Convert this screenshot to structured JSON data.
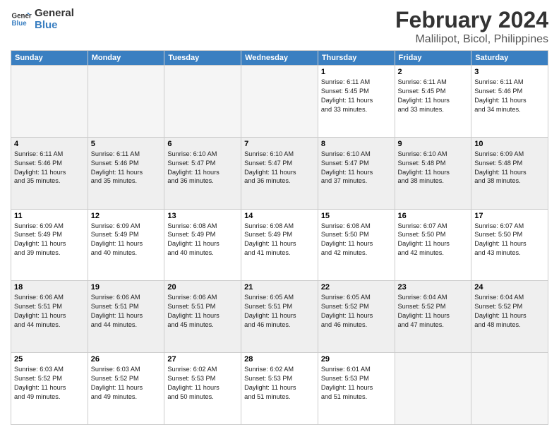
{
  "header": {
    "logo_line1": "General",
    "logo_line2": "Blue",
    "month": "February 2024",
    "location": "Malilipot, Bicol, Philippines"
  },
  "weekdays": [
    "Sunday",
    "Monday",
    "Tuesday",
    "Wednesday",
    "Thursday",
    "Friday",
    "Saturday"
  ],
  "weeks": [
    [
      {
        "day": "",
        "info": "",
        "empty": true
      },
      {
        "day": "",
        "info": "",
        "empty": true
      },
      {
        "day": "",
        "info": "",
        "empty": true
      },
      {
        "day": "",
        "info": "",
        "empty": true
      },
      {
        "day": "1",
        "info": "Sunrise: 6:11 AM\nSunset: 5:45 PM\nDaylight: 11 hours\nand 33 minutes."
      },
      {
        "day": "2",
        "info": "Sunrise: 6:11 AM\nSunset: 5:45 PM\nDaylight: 11 hours\nand 33 minutes."
      },
      {
        "day": "3",
        "info": "Sunrise: 6:11 AM\nSunset: 5:46 PM\nDaylight: 11 hours\nand 34 minutes."
      }
    ],
    [
      {
        "day": "4",
        "info": "Sunrise: 6:11 AM\nSunset: 5:46 PM\nDaylight: 11 hours\nand 35 minutes."
      },
      {
        "day": "5",
        "info": "Sunrise: 6:11 AM\nSunset: 5:46 PM\nDaylight: 11 hours\nand 35 minutes."
      },
      {
        "day": "6",
        "info": "Sunrise: 6:10 AM\nSunset: 5:47 PM\nDaylight: 11 hours\nand 36 minutes."
      },
      {
        "day": "7",
        "info": "Sunrise: 6:10 AM\nSunset: 5:47 PM\nDaylight: 11 hours\nand 36 minutes."
      },
      {
        "day": "8",
        "info": "Sunrise: 6:10 AM\nSunset: 5:47 PM\nDaylight: 11 hours\nand 37 minutes."
      },
      {
        "day": "9",
        "info": "Sunrise: 6:10 AM\nSunset: 5:48 PM\nDaylight: 11 hours\nand 38 minutes."
      },
      {
        "day": "10",
        "info": "Sunrise: 6:09 AM\nSunset: 5:48 PM\nDaylight: 11 hours\nand 38 minutes."
      }
    ],
    [
      {
        "day": "11",
        "info": "Sunrise: 6:09 AM\nSunset: 5:49 PM\nDaylight: 11 hours\nand 39 minutes."
      },
      {
        "day": "12",
        "info": "Sunrise: 6:09 AM\nSunset: 5:49 PM\nDaylight: 11 hours\nand 40 minutes."
      },
      {
        "day": "13",
        "info": "Sunrise: 6:08 AM\nSunset: 5:49 PM\nDaylight: 11 hours\nand 40 minutes."
      },
      {
        "day": "14",
        "info": "Sunrise: 6:08 AM\nSunset: 5:49 PM\nDaylight: 11 hours\nand 41 minutes."
      },
      {
        "day": "15",
        "info": "Sunrise: 6:08 AM\nSunset: 5:50 PM\nDaylight: 11 hours\nand 42 minutes."
      },
      {
        "day": "16",
        "info": "Sunrise: 6:07 AM\nSunset: 5:50 PM\nDaylight: 11 hours\nand 42 minutes."
      },
      {
        "day": "17",
        "info": "Sunrise: 6:07 AM\nSunset: 5:50 PM\nDaylight: 11 hours\nand 43 minutes."
      }
    ],
    [
      {
        "day": "18",
        "info": "Sunrise: 6:06 AM\nSunset: 5:51 PM\nDaylight: 11 hours\nand 44 minutes."
      },
      {
        "day": "19",
        "info": "Sunrise: 6:06 AM\nSunset: 5:51 PM\nDaylight: 11 hours\nand 44 minutes."
      },
      {
        "day": "20",
        "info": "Sunrise: 6:06 AM\nSunset: 5:51 PM\nDaylight: 11 hours\nand 45 minutes."
      },
      {
        "day": "21",
        "info": "Sunrise: 6:05 AM\nSunset: 5:51 PM\nDaylight: 11 hours\nand 46 minutes."
      },
      {
        "day": "22",
        "info": "Sunrise: 6:05 AM\nSunset: 5:52 PM\nDaylight: 11 hours\nand 46 minutes."
      },
      {
        "day": "23",
        "info": "Sunrise: 6:04 AM\nSunset: 5:52 PM\nDaylight: 11 hours\nand 47 minutes."
      },
      {
        "day": "24",
        "info": "Sunrise: 6:04 AM\nSunset: 5:52 PM\nDaylight: 11 hours\nand 48 minutes."
      }
    ],
    [
      {
        "day": "25",
        "info": "Sunrise: 6:03 AM\nSunset: 5:52 PM\nDaylight: 11 hours\nand 49 minutes."
      },
      {
        "day": "26",
        "info": "Sunrise: 6:03 AM\nSunset: 5:52 PM\nDaylight: 11 hours\nand 49 minutes."
      },
      {
        "day": "27",
        "info": "Sunrise: 6:02 AM\nSunset: 5:53 PM\nDaylight: 11 hours\nand 50 minutes."
      },
      {
        "day": "28",
        "info": "Sunrise: 6:02 AM\nSunset: 5:53 PM\nDaylight: 11 hours\nand 51 minutes."
      },
      {
        "day": "29",
        "info": "Sunrise: 6:01 AM\nSunset: 5:53 PM\nDaylight: 11 hours\nand 51 minutes."
      },
      {
        "day": "",
        "info": "",
        "empty": true
      },
      {
        "day": "",
        "info": "",
        "empty": true
      }
    ]
  ]
}
